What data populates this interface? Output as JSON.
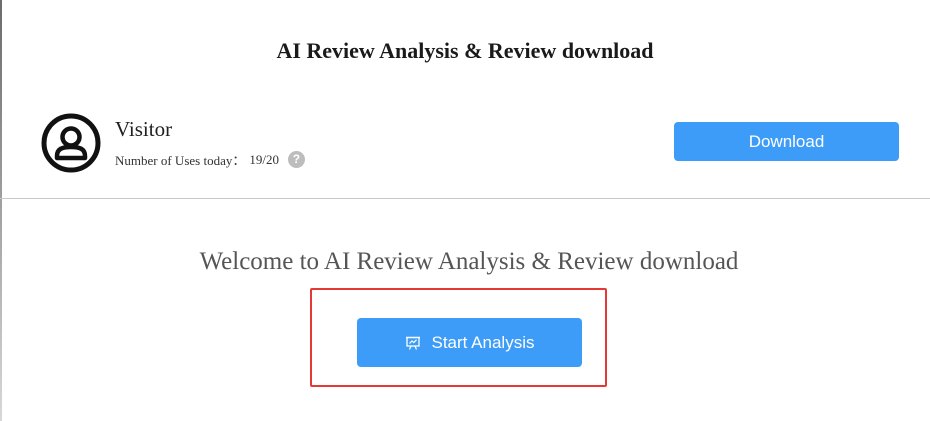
{
  "modal": {
    "title": "AI Review Analysis & Review download"
  },
  "user": {
    "name": "Visitor",
    "uses_label": "Number of Uses today：",
    "uses_value": "19/20",
    "avatar_icon": "user-circle-icon",
    "help_icon": "question-circle-icon",
    "help_glyph": "?"
  },
  "actions": {
    "download_label": "Download",
    "start_label": "Start Analysis",
    "start_icon": "presentation-chart-icon"
  },
  "welcome": {
    "text": "Welcome to AI Review Analysis & Review download"
  },
  "colors": {
    "primary": "#3d9cf8",
    "highlight": "#e53935",
    "divider": "#c8c8c8",
    "help_icon_bg": "#bdbdbd"
  }
}
